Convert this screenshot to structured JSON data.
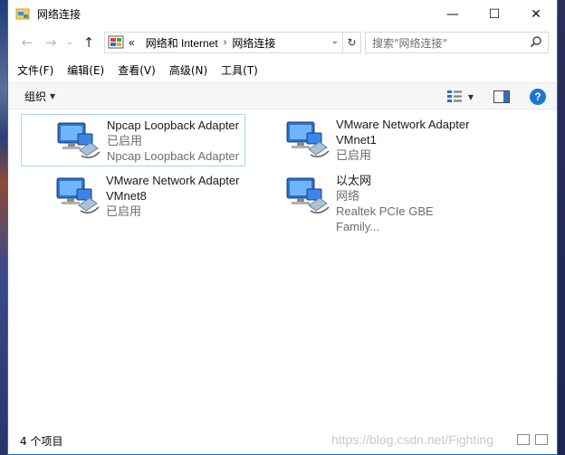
{
  "window": {
    "title": "网络连接"
  },
  "controls": {
    "minimize": "—",
    "maximize": "☐",
    "close": "✕"
  },
  "nav": {
    "back": "←",
    "forward": "→",
    "recent": "⌄",
    "up": "↑"
  },
  "address": {
    "prefix": "«",
    "segments": [
      "网络和 Internet",
      "网络连接"
    ],
    "separator": "›"
  },
  "search": {
    "placeholder": "搜索\"网络连接\""
  },
  "menu": {
    "items": [
      "文件(F)",
      "编辑(E)",
      "查看(V)",
      "高级(N)",
      "工具(T)"
    ]
  },
  "command": {
    "organize": "组织",
    "help": "?"
  },
  "adapters": [
    {
      "name": "Npcap Loopback Adapter",
      "status": "已启用",
      "device": "Npcap Loopback Adapter",
      "selected": true
    },
    {
      "name": "VMware Network Adapter VMnet1",
      "status": "已启用",
      "device": "",
      "selected": false
    },
    {
      "name": "VMware Network Adapter VMnet8",
      "status": "已启用",
      "device": "",
      "selected": false
    },
    {
      "name": "以太网",
      "status": "网络",
      "device": "Realtek PCIe GBE Family...",
      "selected": false
    }
  ],
  "status": {
    "count": "4 个项目"
  },
  "watermark": "https://blog.csdn.net/Fighting"
}
